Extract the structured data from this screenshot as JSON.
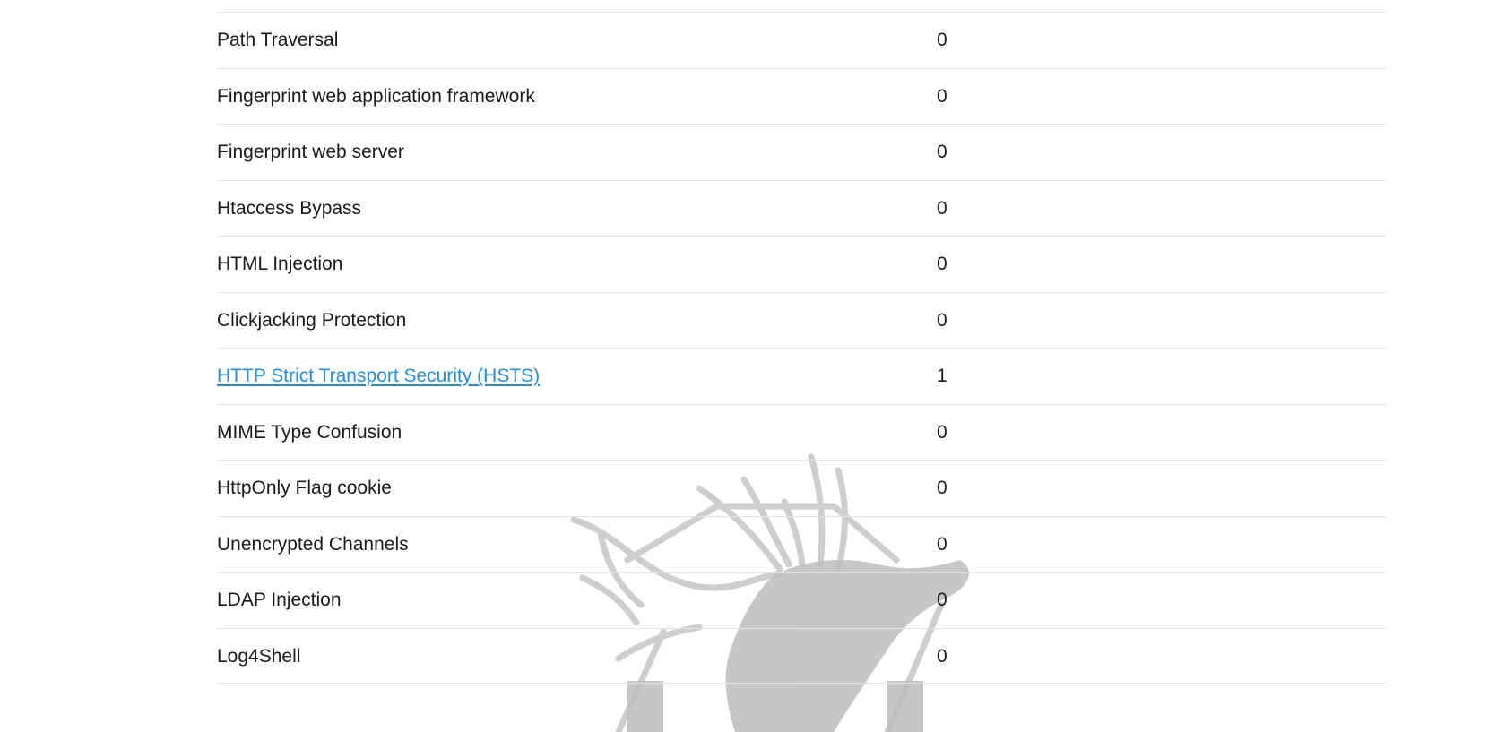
{
  "table": {
    "rows": [
      {
        "name": "Path Traversal",
        "count": "0",
        "link": false
      },
      {
        "name": "Fingerprint web application framework",
        "count": "0",
        "link": false
      },
      {
        "name": "Fingerprint web server",
        "count": "0",
        "link": false
      },
      {
        "name": "Htaccess Bypass",
        "count": "0",
        "link": false
      },
      {
        "name": "HTML Injection",
        "count": "0",
        "link": false
      },
      {
        "name": "Clickjacking Protection",
        "count": "0",
        "link": false
      },
      {
        "name": "HTTP Strict Transport Security (HSTS)",
        "count": "1",
        "link": true
      },
      {
        "name": "MIME Type Confusion",
        "count": "0",
        "link": false
      },
      {
        "name": "HttpOnly Flag cookie",
        "count": "0",
        "link": false
      },
      {
        "name": "Unencrypted Channels",
        "count": "0",
        "link": false
      },
      {
        "name": "LDAP Injection",
        "count": "0",
        "link": false
      },
      {
        "name": "Log4Shell",
        "count": "0",
        "link": false
      }
    ]
  },
  "colors": {
    "link": "#1f8fe6",
    "text": "#1a1a1a",
    "divider": "#e4e4e4",
    "watermark": "#cccccc"
  },
  "watermark": {
    "icon": "elk-head-logo-icon"
  }
}
